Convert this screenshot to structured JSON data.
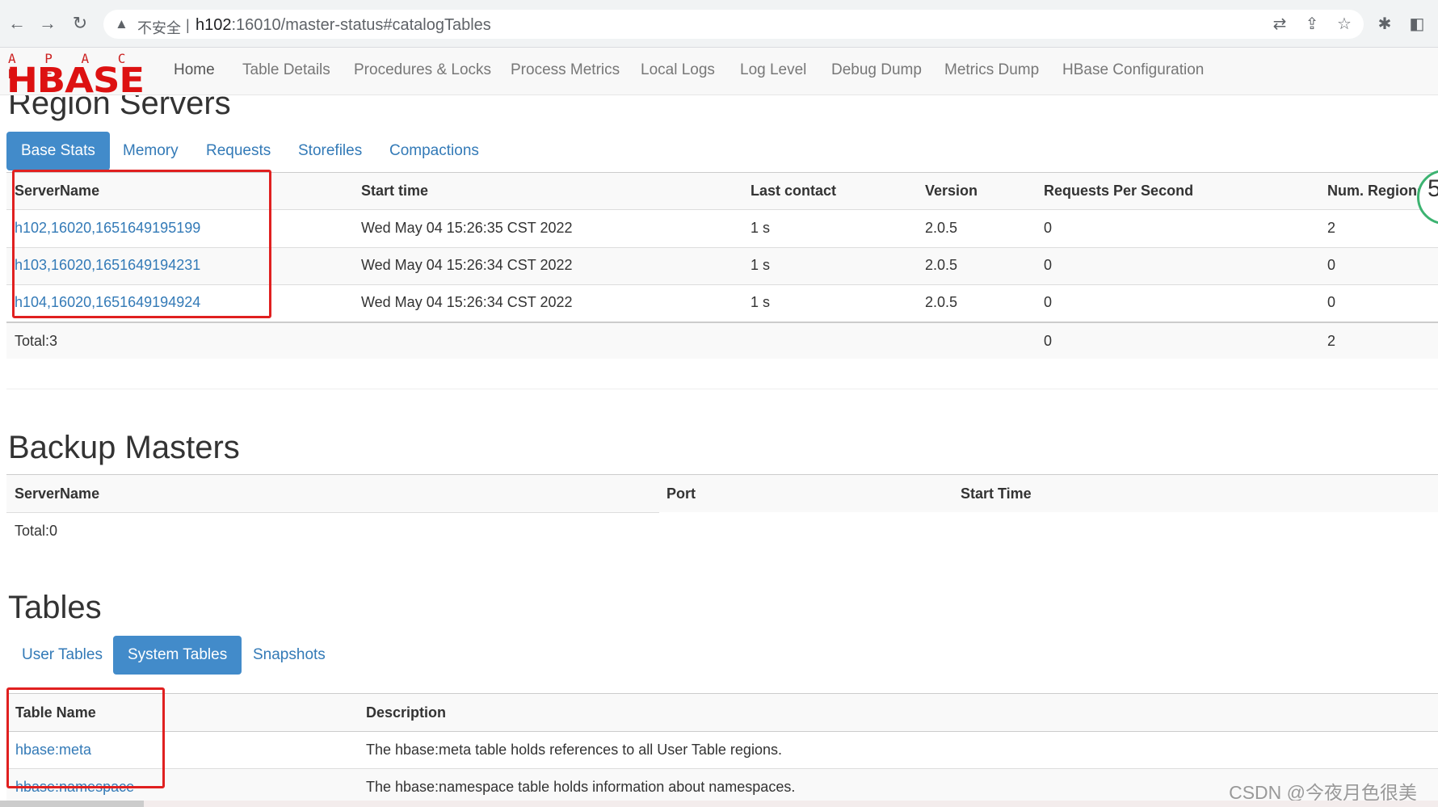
{
  "browser": {
    "insecure_label": "不安全",
    "url_host": "h102",
    "url_rest": ":16010/master-status#catalogTables"
  },
  "logo": {
    "top": "A P A C H E",
    "main": "HBASE"
  },
  "nav": [
    "Home",
    "Table Details",
    "Procedures & Locks",
    "Process Metrics",
    "Local Logs",
    "Log Level",
    "Debug Dump",
    "Metrics Dump",
    "HBase Configuration"
  ],
  "region_servers": {
    "title": "Region Servers",
    "tabs": [
      "Base Stats",
      "Memory",
      "Requests",
      "Storefiles",
      "Compactions"
    ],
    "headers": [
      "ServerName",
      "Start time",
      "Last contact",
      "Version",
      "Requests Per Second",
      "Num. Regions"
    ],
    "rows": [
      [
        "h102,16020,1651649195199",
        "Wed May 04 15:26:35 CST 2022",
        "1 s",
        "2.0.5",
        "0",
        "2"
      ],
      [
        "h103,16020,1651649194231",
        "Wed May 04 15:26:34 CST 2022",
        "1 s",
        "2.0.5",
        "0",
        "0"
      ],
      [
        "h104,16020,1651649194924",
        "Wed May 04 15:26:34 CST 2022",
        "1 s",
        "2.0.5",
        "0",
        "0"
      ]
    ],
    "total": {
      "label": "Total:3",
      "requests": "0",
      "regions": "2"
    }
  },
  "backup_masters": {
    "title": "Backup Masters",
    "headers": [
      "ServerName",
      "Port",
      "Start Time"
    ],
    "total": "Total:0"
  },
  "tables": {
    "title": "Tables",
    "tabs": [
      "User Tables",
      "System Tables",
      "Snapshots"
    ],
    "headers": [
      "Table Name",
      "Description"
    ],
    "rows": [
      [
        "hbase:meta",
        "The hbase:meta table holds references to all User Table regions."
      ],
      [
        "hbase:namespace",
        "The hbase:namespace table holds information about namespaces."
      ]
    ]
  },
  "side_badge": "5",
  "watermark": "CSDN @今夜月色很美"
}
